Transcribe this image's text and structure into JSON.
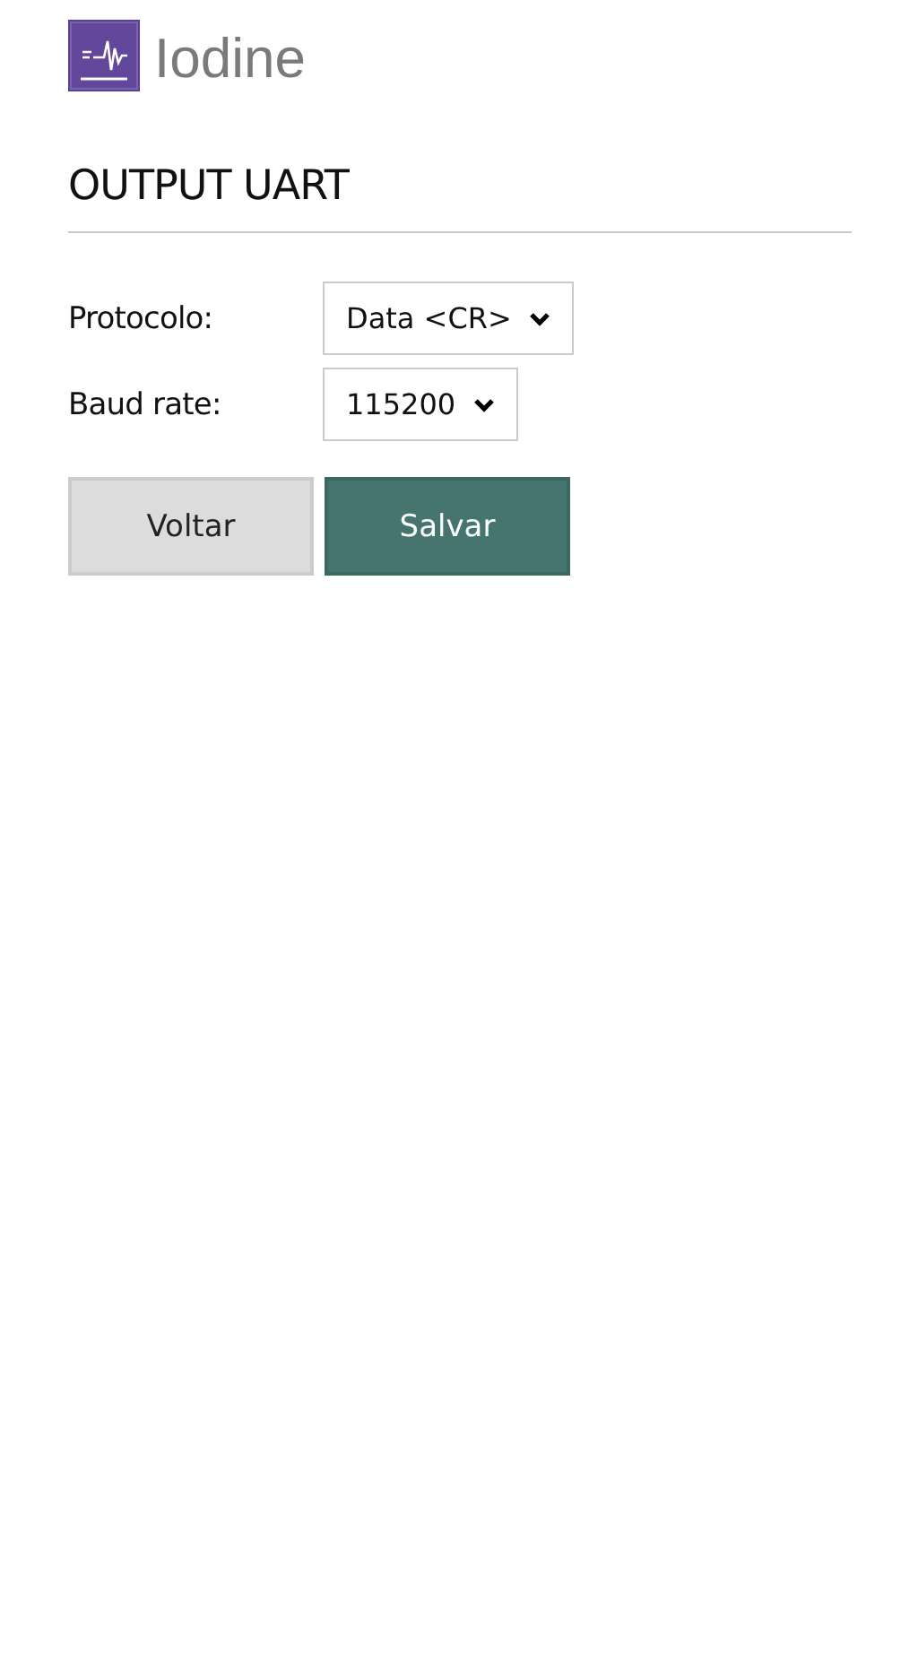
{
  "logo": {
    "text": "Iodine"
  },
  "heading": "OUTPUT UART",
  "fields": [
    {
      "label": "Protocolo:",
      "value": "Data <CR>"
    },
    {
      "label": "Baud rate:",
      "value": "115200"
    }
  ],
  "buttons": [
    {
      "label": "Voltar",
      "kind": "secondary"
    },
    {
      "label": "Salvar",
      "kind": "primary"
    }
  ]
}
